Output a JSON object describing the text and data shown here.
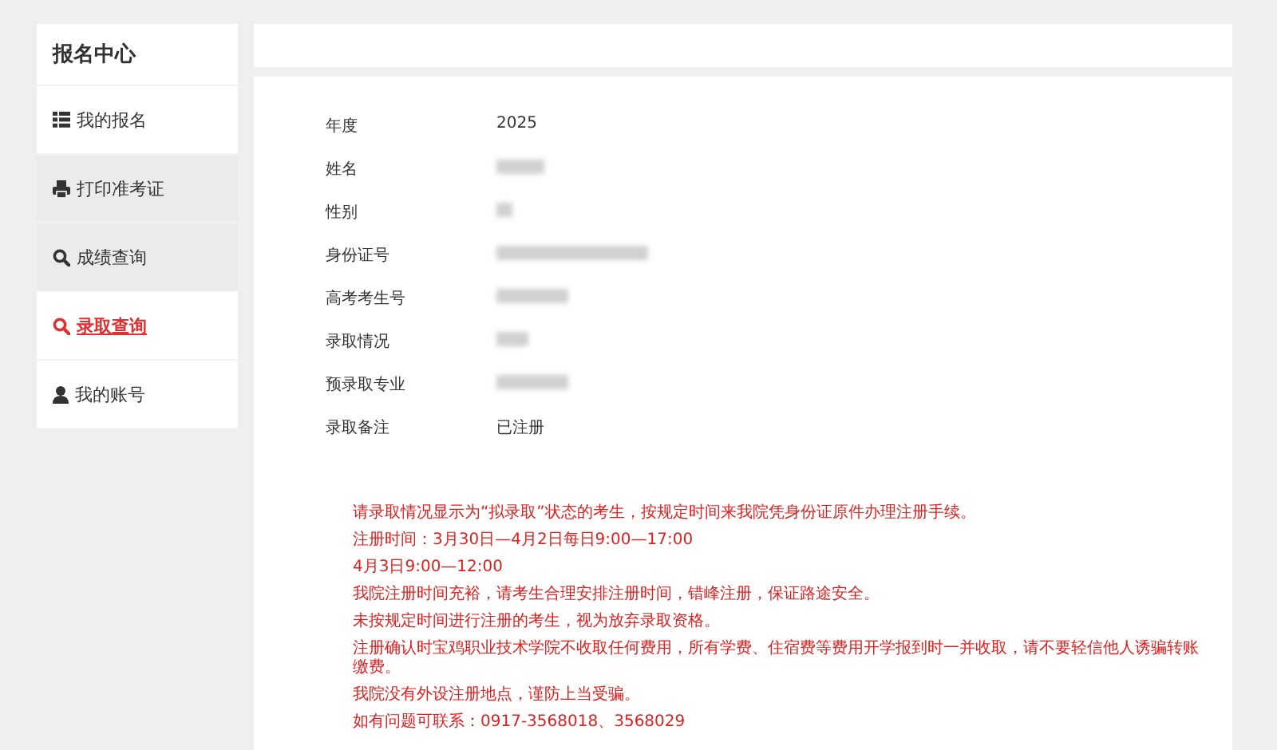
{
  "sidebar": {
    "title": "报名中心",
    "items": [
      {
        "label": "我的报名",
        "kind": "list",
        "selected": false,
        "shaded": false
      },
      {
        "label": "打印准考证",
        "kind": "print",
        "selected": false,
        "shaded": true
      },
      {
        "label": "成绩查询",
        "kind": "search",
        "selected": false,
        "shaded": true
      },
      {
        "label": "录取查询",
        "kind": "search",
        "selected": true,
        "shaded": false
      },
      {
        "label": "我的账号",
        "kind": "user",
        "selected": false,
        "shaded": false
      }
    ]
  },
  "details": [
    {
      "label": "年度",
      "kind": "text",
      "value": "2025"
    },
    {
      "label": "姓名",
      "kind": "blurred"
    },
    {
      "label": "性别",
      "kind": "blurred"
    },
    {
      "label": "身份证号",
      "kind": "blurred"
    },
    {
      "label": "高考考生号",
      "kind": "blurred"
    },
    {
      "label": "录取情况",
      "kind": "blurred"
    },
    {
      "label": "预录取专业",
      "kind": "blurred"
    },
    {
      "label": "录取备注",
      "kind": "text",
      "value": "已注册"
    }
  ],
  "notices": [
    "请录取情况显示为“拟录取”状态的考生，按规定时间来我院凭身份证原件办理注册手续。",
    "注册时间：3月30日—4月2日每日9:00—17:00",
    "4月3日9:00—12:00",
    "我院注册时间充裕，请考生合理安排注册时间，错峰注册，保证路途安全。",
    "未按规定时间进行注册的考生，视为放弃录取资格。",
    "注册确认时宝鸡职业技术学院不收取任何费用，所有学费、住宿费等费用开学报到时一并收取，请不要轻信他人诱骗转账缴费。",
    "我院没有外设注册地点，谨防上当受骗。",
    "如有问题可联系：0917-3568018、3568029"
  ]
}
